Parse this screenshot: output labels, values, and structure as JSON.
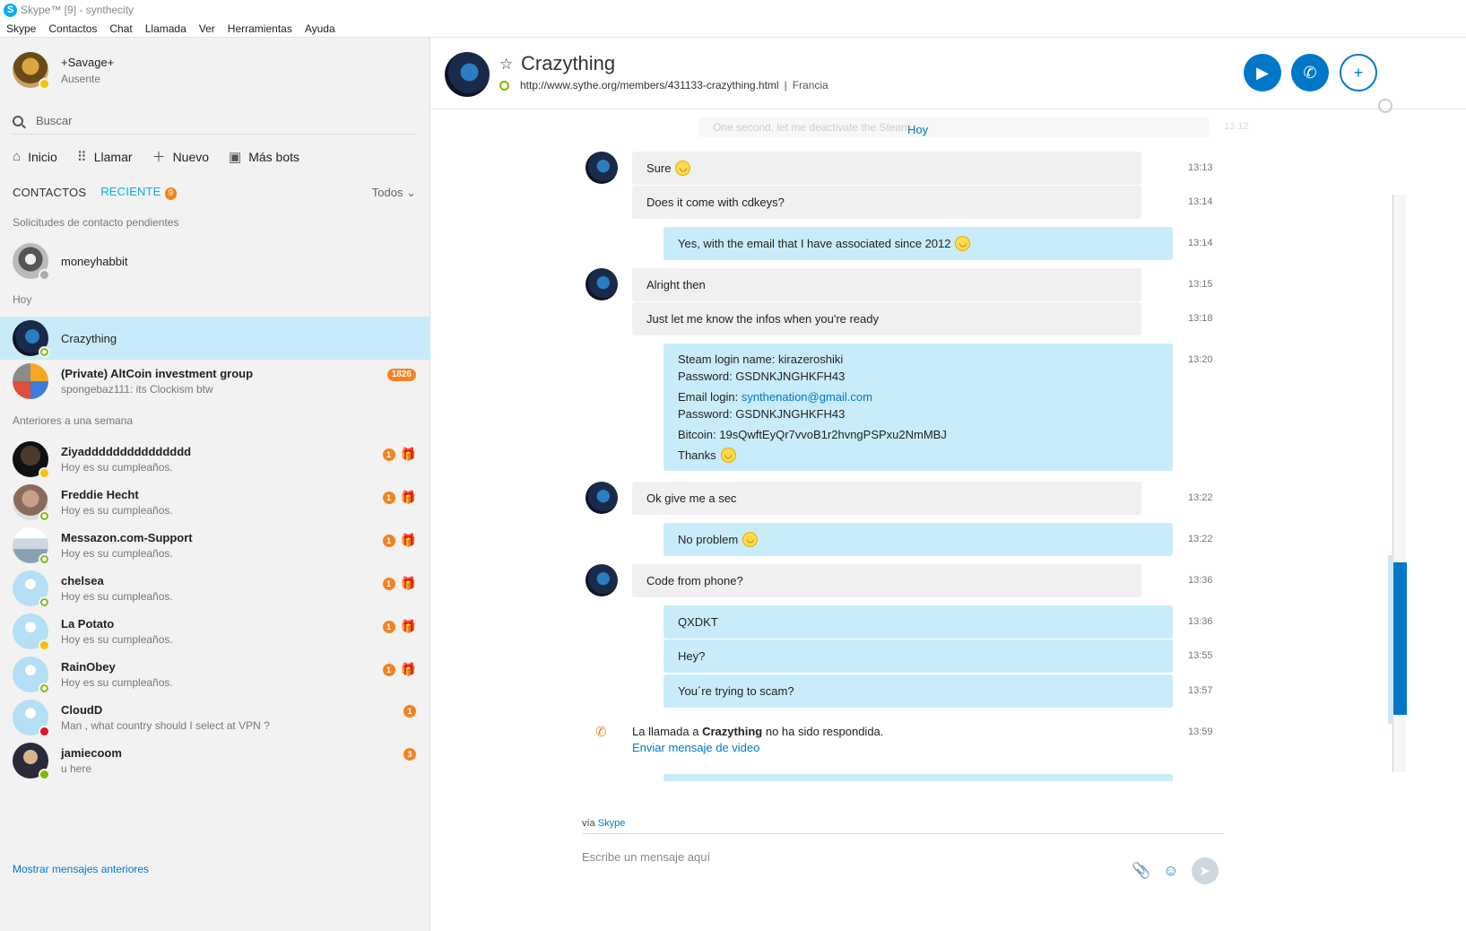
{
  "window": {
    "title": "Skype™ [9] - synthecity"
  },
  "menu": [
    "Skype",
    "Contactos",
    "Chat",
    "Llamada",
    "Ver",
    "Herramientas",
    "Ayuda"
  ],
  "profile": {
    "name": "+Savage+",
    "status": "Ausente"
  },
  "search": {
    "placeholder": "Buscar"
  },
  "nav": {
    "home": "Inicio",
    "call": "Llamar",
    "new": "Nuevo",
    "bots": "Más bots"
  },
  "tabs": {
    "contacts": "CONTACTOS",
    "recent": "RECIENTE",
    "recent_count": "9",
    "filter": "Todos"
  },
  "sections": {
    "pending": "Solicitudes de contacto pendientes",
    "today": "Hoy",
    "week": "Anteriores a una semana"
  },
  "pending": {
    "name": "moneyhabbit"
  },
  "today": [
    {
      "name": "Crazything"
    },
    {
      "name": "(Private) AltCoin investment group",
      "msg": "spongebaz111: its Clockism btw",
      "count": "1826"
    }
  ],
  "week": [
    {
      "name": "Ziyaddddddddddddddd",
      "msg": "Hoy es su cumpleaños.",
      "count": "1"
    },
    {
      "name": "Freddie Hecht",
      "msg": "Hoy es su cumpleaños.",
      "count": "1"
    },
    {
      "name": "Messazon.com-Support",
      "msg": "Hoy es su cumpleaños.",
      "count": "1"
    },
    {
      "name": "chelsea",
      "msg": "Hoy es su cumpleaños.",
      "count": "1"
    },
    {
      "name": "La Potato",
      "msg": "Hoy es su cumpleaños.",
      "count": "1"
    },
    {
      "name": "RainObey",
      "msg": "Hoy es su cumpleaños.",
      "count": "1"
    },
    {
      "name": "CloudD",
      "msg": "Man , what country should I select at VPN ?",
      "count": "1"
    },
    {
      "name": "jamiecoom",
      "msg": "u here",
      "count": "3"
    }
  ],
  "more_link": "Mostrar mensajes anteriores",
  "chat": {
    "name": "Crazything",
    "url": "http://www.sythe.org/members/431133-crazything.html",
    "location": "Francia",
    "sep": "|",
    "faded_msg": "One second, let me deactivate the Steam...",
    "faded_time": "13:12",
    "date_label": "Hoy",
    "messages": [
      {
        "text": "Sure",
        "time": "13:13"
      },
      {
        "text": "Does it come with cdkeys?",
        "time": "13:14"
      },
      {
        "text": "Yes, with the email that I have associated since 2012",
        "time": "13:14"
      },
      {
        "text": "Alright then",
        "time": "13:15"
      },
      {
        "text": "Just let me know the infos when you're ready",
        "time": "13:18"
      },
      {
        "time": "13:20",
        "lines": {
          "steam": "Steam login name: kirazeroshiki",
          "pass1": "Password: GSDNKJNGHKFH43",
          "email_prefix": "Email login: ",
          "email": "synthenation@gmail.com",
          "pass2": "Password: GSDNKJNGHKFH43",
          "btc": "Bitcoin: 19sQwftEyQr7vvoB1r2hvngPSPxu2NmMBJ",
          "thanks": "Thanks"
        }
      },
      {
        "text": "Ok give me a sec",
        "time": "13:22"
      },
      {
        "text": "No problem",
        "time": "13:22"
      },
      {
        "text": "Code from phone?",
        "time": "13:36"
      },
      {
        "text": "QXDKT",
        "time": "13:36"
      },
      {
        "text": "Hey?",
        "time": "13:55"
      },
      {
        "text": "You´re trying to scam?",
        "time": "13:57"
      }
    ],
    "call": {
      "prefix": "La llamada a ",
      "name": "Crazything",
      "suffix": " no ha sido respondida.",
      "link": "Enviar mensaje de video",
      "time": "13:59"
    }
  },
  "footer": {
    "via": "vía",
    "via_link": "Skype",
    "placeholder": "Escribe un mensaje aquí"
  },
  "colors": {
    "accent": "#0078ca",
    "skype_blue": "#00aff0",
    "badge": "#f58220",
    "bubble_out": "#c9ecfb",
    "bubble_in": "#f0f0f0"
  },
  "icons": [
    "skype-logo-icon",
    "search-icon",
    "home-icon",
    "dialpad-icon",
    "plus-icon",
    "bot-icon",
    "star-icon",
    "video-call-icon",
    "phone-icon",
    "add-person-icon",
    "globe-icon",
    "missed-call-icon",
    "paperclip-icon",
    "emoticon-icon",
    "send-icon",
    "gift-icon"
  ]
}
